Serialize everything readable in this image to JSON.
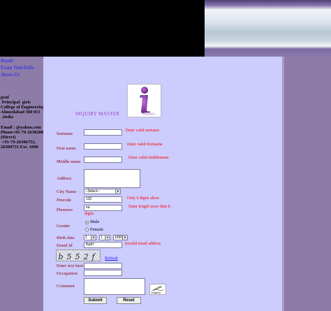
{
  "sidebar": {
    "links": [
      "Result",
      "Exam TimeTable",
      "About Us"
    ],
    "address_lines": [
      "prof",
      " Principal  girls",
      "College of Engineering",
      "Ahmedabad 380 015",
      " ,India",
      "",
      "Email : @yahoo.com",
      "Phone+91-79-26302887",
      "(Direct)",
      " +91-79-26306752,",
      "26300735 Ext. 1000"
    ]
  },
  "form": {
    "title": "INQUIRY MASTER",
    "logo_letter": "i",
    "labels": {
      "surname": "Surname",
      "firstname": "First name",
      "middlename": "Middle name",
      "address": "Address",
      "city": "City Name",
      "pincode": "Pincode",
      "phone": "Phoneno",
      "gender": "Gender",
      "birthdate": "Birth date",
      "email": "Email Id",
      "captcha_text": "Enter text here",
      "occupation": "Occupation",
      "comment": "Comment"
    },
    "errors": {
      "surname": "Enter valid surname",
      "firstname": "Enter valid firstname",
      "middlename": "Enter valid middlename",
      "pincode": "Only 6 digits allow",
      "phone_line1": "Enter length more than 8",
      "phone_line2": "digits",
      "email": "Invalid email address"
    },
    "values": {
      "city": "--Select--",
      "pincode": "132",
      "phone": "ea",
      "email": "fkghf",
      "birth_day": "1",
      "birth_month": "1",
      "birth_year": "1990"
    },
    "gender_options": [
      "Male",
      "Female"
    ],
    "gender_selected": "Male",
    "captcha": "b552f",
    "refresh_label": "Refresh",
    "inquiry_icon_label": "Inquiry",
    "submit_label": "Submit",
    "reset_label": "Reset"
  }
}
